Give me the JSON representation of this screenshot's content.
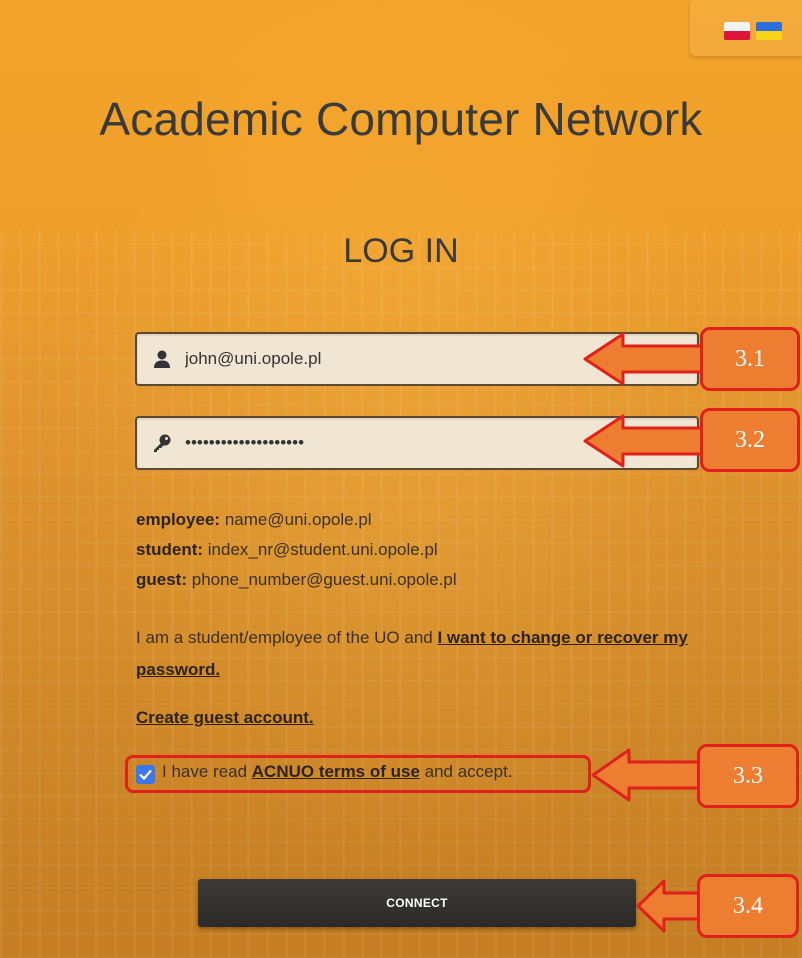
{
  "app": {
    "title": "Academic Computer Network",
    "subtitle": "LOG IN"
  },
  "languages": [
    {
      "code": "pl",
      "icon": "flag-poland-icon"
    },
    {
      "code": "ua",
      "icon": "flag-ukraine-icon"
    }
  ],
  "form": {
    "username_value": "john@uni.opole.pl",
    "username_icon": "user-icon",
    "password_value": "••••••••••••••••••••",
    "password_icon": "key-icon"
  },
  "hints": {
    "employee_label": "employee:",
    "employee_value": "name@uni.opole.pl",
    "student_label": "student:",
    "student_value": "index_nr@student.uni.opole.pl",
    "guest_label": "guest:",
    "guest_value": "phone_number@guest.uni.opole.pl"
  },
  "recover": {
    "text": "I am a student/employee of the UO and ",
    "link": "I want to change or recover my password."
  },
  "guest_account_link": "Create guest account.",
  "terms": {
    "checked": true,
    "prefix": "I have read ",
    "link": "ACNUO terms of use",
    "suffix": " and accept."
  },
  "connect_label": "CONNECT",
  "annotations": {
    "a1": "3.1",
    "a2": "3.2",
    "a3": "3.3",
    "a4": "3.4",
    "color": "#ed7d31",
    "border_color": "#e0201a"
  },
  "colors": {
    "background": "#f0a02b",
    "title_text": "#3a3a3a",
    "field_bg": "#f1e6d4",
    "button_bg": "#2c2a28",
    "checkbox": "#3b78e7"
  }
}
